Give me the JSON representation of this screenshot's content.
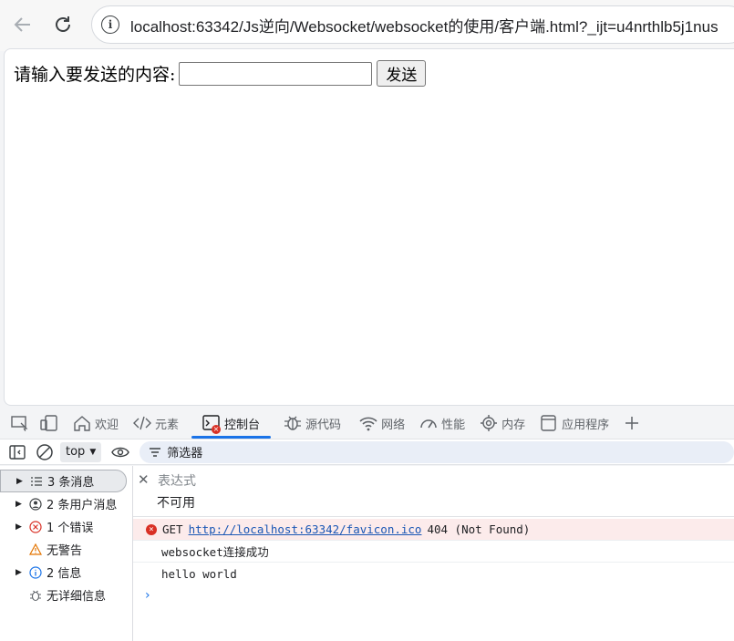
{
  "browser": {
    "url": "localhost:63342/Js逆向/Websocket/websocket的使用/客户端.html?_ijt=u4nrthlb5j1nus"
  },
  "page": {
    "label": "请输入要发送的内容:",
    "input_value": "",
    "send_label": "发送"
  },
  "devtools": {
    "tabs": [
      {
        "label": "欢迎",
        "icon": "home-icon"
      },
      {
        "label": "元素",
        "icon": "code-icon"
      },
      {
        "label": "控制台",
        "icon": "console-icon"
      },
      {
        "label": "源代码",
        "icon": "bug-icon"
      },
      {
        "label": "网络",
        "icon": "wifi-icon"
      },
      {
        "label": "性能",
        "icon": "gauge-icon"
      },
      {
        "label": "内存",
        "icon": "chip-icon"
      },
      {
        "label": "应用程序",
        "icon": "app-icon"
      }
    ],
    "active_tab": "控制台",
    "console_toolbar": {
      "context": "top",
      "filter_label": "筛选器"
    },
    "sidebar": [
      {
        "label": "3 条消息",
        "icon": "list-icon"
      },
      {
        "label": "2 条用户消息",
        "icon": "user-icon"
      },
      {
        "label": "1 个错误",
        "icon": "error-icon"
      },
      {
        "label": "无警告",
        "icon": "warning-icon"
      },
      {
        "label": "2 信息",
        "icon": "info-icon"
      },
      {
        "label": "无详细信息",
        "icon": "bug-icon"
      }
    ],
    "live_expression": {
      "title": "表达式",
      "value": "不可用"
    },
    "messages": {
      "error": {
        "method": "GET",
        "link": "http://localhost:63342/favicon.ico",
        "status": "404 (Not Found)"
      },
      "log1": "websocket连接成功",
      "log2": "hello world"
    },
    "prompt": "›"
  },
  "colors": {
    "accent": "#1a73e8",
    "error": "#d93025",
    "error_bg": "#fcebeb"
  }
}
